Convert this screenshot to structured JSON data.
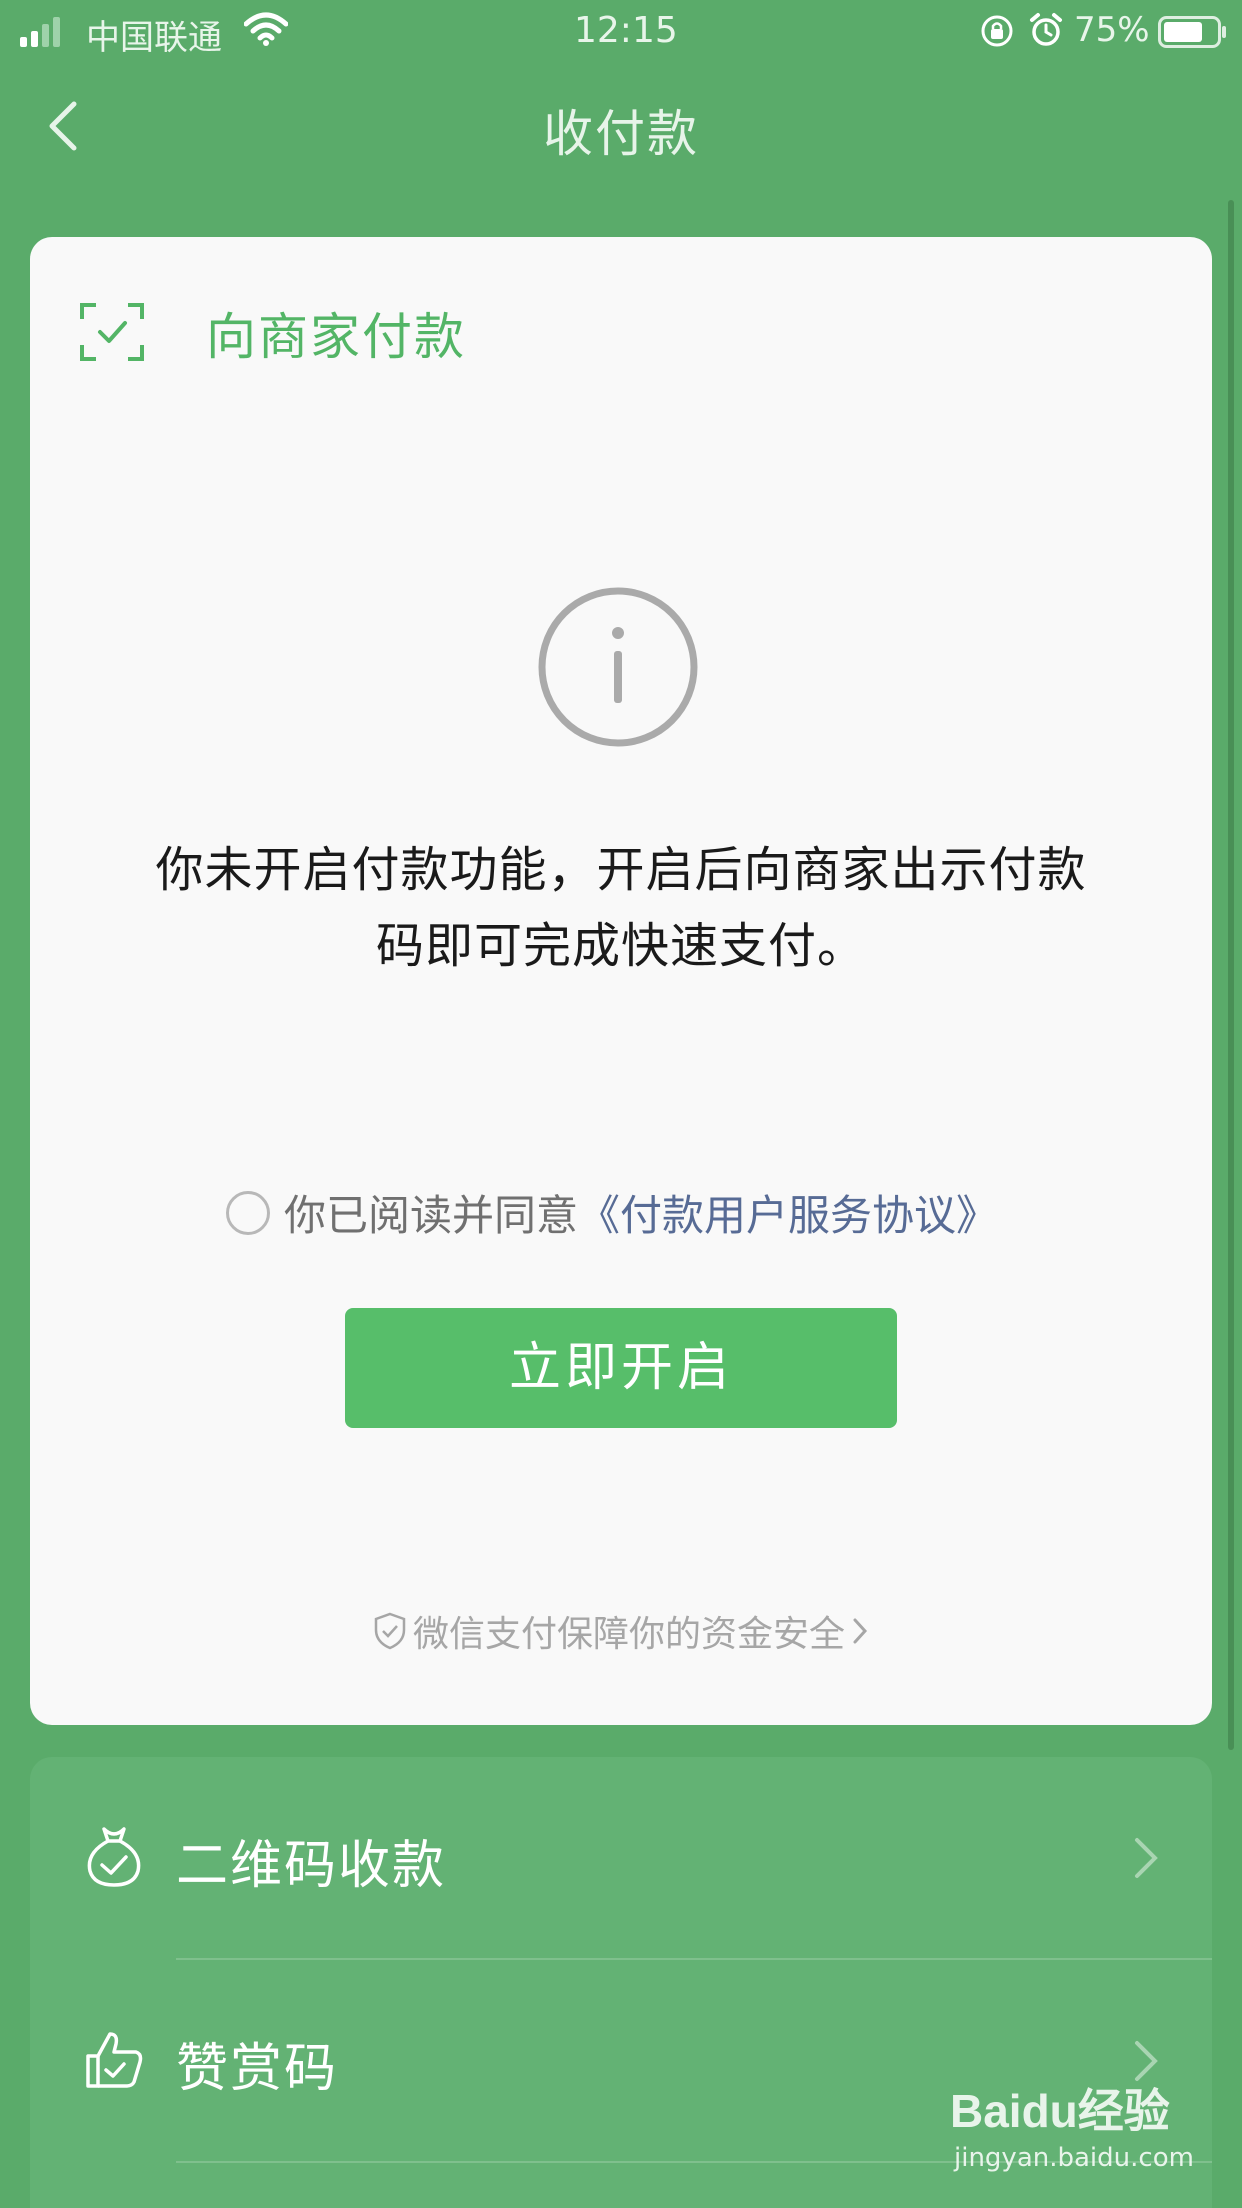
{
  "status_bar": {
    "carrier": "中国联通",
    "time": "12:15",
    "battery_percent": "75%",
    "battery_level": 0.75
  },
  "nav": {
    "title": "收付款",
    "back_icon": "chevron-left-icon"
  },
  "pay_card": {
    "header_label": "向商家付款",
    "header_icon": "scan-check-icon",
    "status_icon": "info-icon",
    "notice_line1": "你未开启付款功能，开启后向商家出示付款",
    "notice_line2": "码即可完成快速支付。",
    "agreement_text": "你已阅读并同意",
    "agreement_link": "《付款用户服务协议》",
    "agreement_checked": false,
    "open_button_label": "立即开启",
    "security_note": "微信支付保障你的资金安全",
    "accent_color": "#57be6a",
    "link_color": "#576b95"
  },
  "menu": {
    "items": [
      {
        "label": "二维码收款",
        "icon": "money-bag-icon"
      },
      {
        "label": "赞赏码",
        "icon": "thumbs-up-icon"
      }
    ]
  },
  "watermark": {
    "logo": "Baidu经验",
    "url": "jingyan.baidu.com"
  }
}
